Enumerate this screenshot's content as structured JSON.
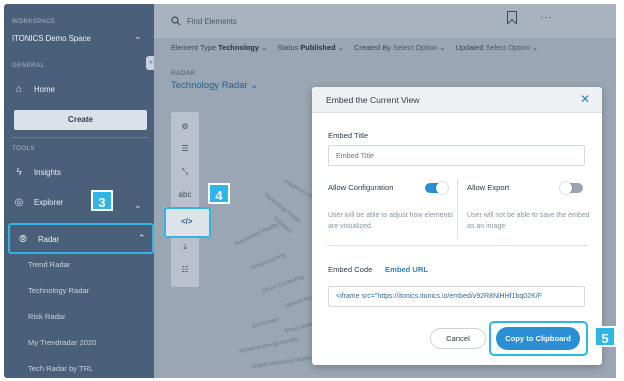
{
  "sidebar": {
    "workspace_label": "WORKSPACE",
    "workspace_name": "ITONICS Demo Space",
    "general_label": "GENERAL",
    "home_label": "Home",
    "create_label": "Create",
    "tools_label": "TOOLS",
    "insights_label": "Insights",
    "explorer_label": "Explorer",
    "radar_label": "Radar",
    "radar_subitems": [
      "Trend Radar",
      "Technology Radar",
      "Risk Radar",
      "My Trendradar 2020",
      "Tech Radar by TRL"
    ]
  },
  "steps": {
    "three": "3",
    "four": "4",
    "five": "5"
  },
  "topbar": {
    "search_placeholder": "Find Elements",
    "more_label": "···"
  },
  "filters": {
    "element_type_label": "Element Type",
    "element_type_value": "Technology",
    "status_label": "Status",
    "status_value": "Published",
    "created_by_label": "Created By",
    "created_by_value": "Select Option",
    "updated_label": "Updated",
    "updated_value": "Select Option"
  },
  "radar": {
    "section_label": "RADAR",
    "title": "Technology Radar",
    "background_labels": [
      "Technology Radar",
      "Augmented Reality",
      "Deep Learning",
      "Wireless energy transfer",
      "Digital Marketing Platforms",
      "Speech Recognition",
      "Cloud Computing",
      "Robotics",
      "Smart Materials",
      "Predictive Analytics",
      "Blockchain"
    ]
  },
  "icons": {
    "search": "search-icon",
    "close": "close-icon",
    "embed": "code-icon"
  },
  "dialog": {
    "title": "Embed the Current View",
    "embed_title_label": "Embed Title",
    "embed_title_placeholder": "Embed Title",
    "allow_config_label": "Allow Configuration",
    "allow_config_on": true,
    "allow_config_desc": "User will be able to adjust how elements are visualized.",
    "allow_export_label": "Allow Export",
    "allow_export_on": false,
    "allow_export_desc": "User will not be able to save the embed as an image",
    "tab_embed_code": "Embed Code",
    "tab_embed_url": "Embed URL",
    "code_value": "<iframe src=\"https://itonics.itonics.io/embed/v92R8NiHHf1bq02K/F",
    "cancel_label": "Cancel",
    "copy_label": "Copy to Clipboard"
  },
  "colors": {
    "accent": "#2fb6e6",
    "primary": "#2a8fd4",
    "sidebar": "#4a5f7a"
  }
}
